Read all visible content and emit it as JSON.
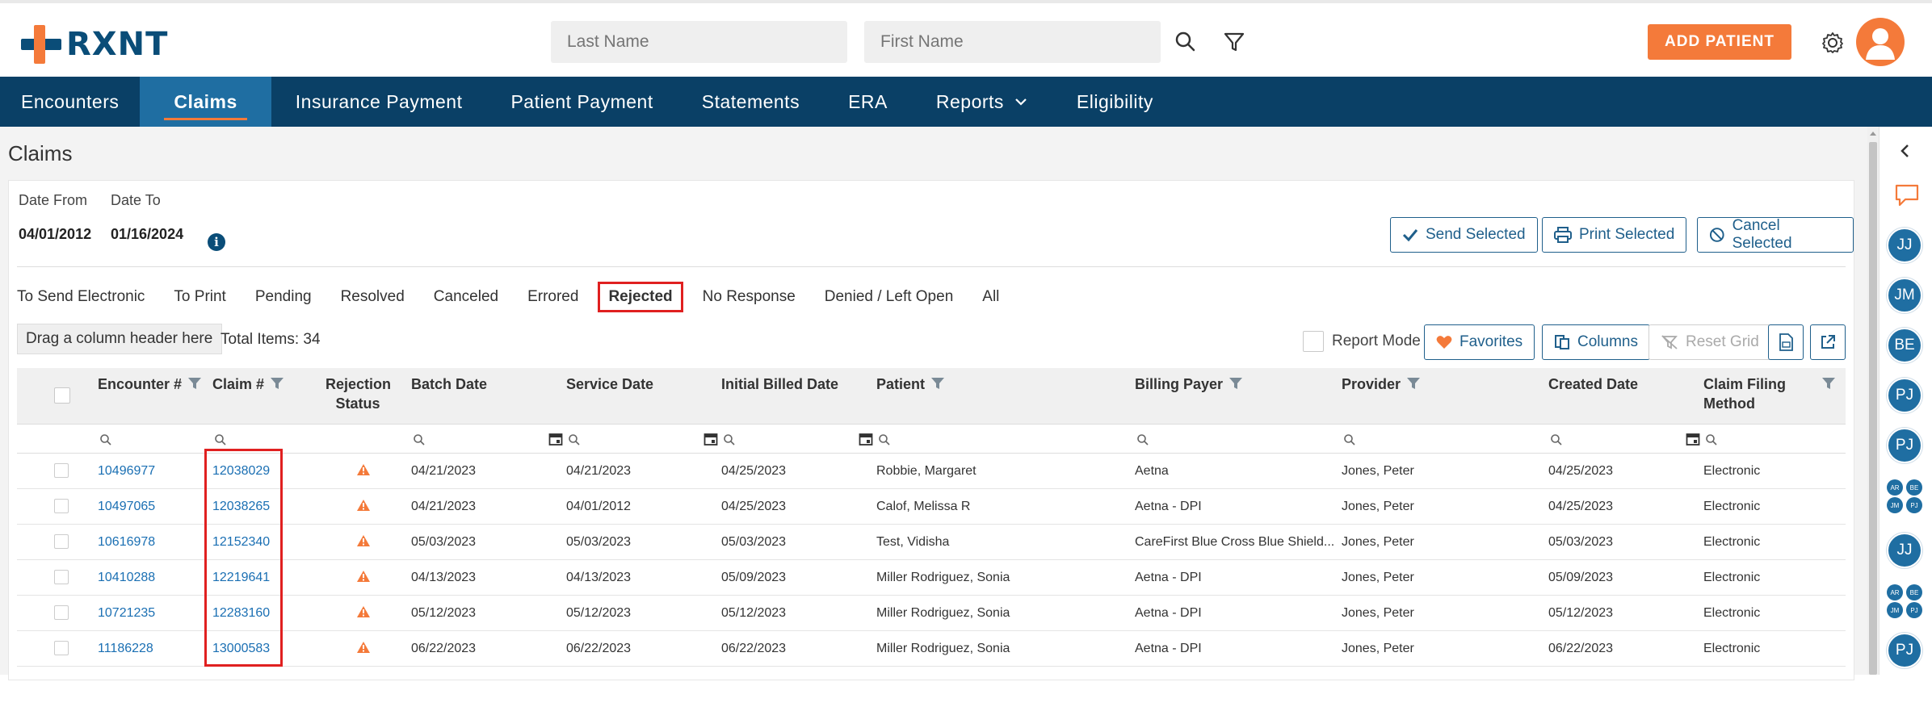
{
  "header": {
    "logo_text": "RXNT",
    "last_name_placeholder": "Last Name",
    "first_name_placeholder": "First Name",
    "add_patient_label": "ADD PATIENT",
    "accent_color": "#f47a3a",
    "brand_color": "#0a4066"
  },
  "nav": {
    "items": [
      "Encounters",
      "Claims",
      "Insurance Payment",
      "Patient Payment",
      "Statements",
      "ERA",
      "Reports",
      "Eligibility"
    ],
    "active": "Claims"
  },
  "page": {
    "title": "Claims"
  },
  "filters": {
    "date_from_label": "Date From",
    "date_to_label": "Date To",
    "date_from_value": "04/01/2012",
    "date_to_value": "01/16/2024"
  },
  "actions": {
    "send_selected": "Send Selected",
    "print_selected": "Print Selected",
    "cancel_selected": "Cancel Selected"
  },
  "tabs": [
    "To Send Electronic",
    "To Print",
    "Pending",
    "Resolved",
    "Canceled",
    "Errored",
    "Rejected",
    "No Response",
    "Denied / Left Open",
    "All"
  ],
  "selected_tab": "Rejected",
  "toolbar": {
    "group_hint": "Drag a column header here",
    "total_items": "Total Items: 34",
    "report_mode": "Report Mode",
    "favorites": "Favorites",
    "columns": "Columns",
    "reset_grid": "Reset Grid"
  },
  "grid": {
    "columns": {
      "encounter": "Encounter #",
      "claim": "Claim #",
      "rejection_status_1": "Rejection",
      "rejection_status_2": "Status",
      "batch_date": "Batch Date",
      "service_date": "Service Date",
      "initial_billed_date": "Initial Billed Date",
      "patient": "Patient",
      "billing_payer": "Billing Payer",
      "provider": "Provider",
      "created_date": "Created Date",
      "claim_filing_1": "Claim Filing",
      "claim_filing_2": "Method"
    },
    "rows": [
      {
        "encounter": "10496977",
        "claim": "12038029",
        "batch": "04/21/2023",
        "service": "04/21/2023",
        "billed": "04/25/2023",
        "patient": "Robbie, Margaret",
        "payer": "Aetna",
        "provider": "Jones, Peter",
        "created": "04/25/2023",
        "method": "Electronic"
      },
      {
        "encounter": "10497065",
        "claim": "12038265",
        "batch": "04/21/2023",
        "service": "04/01/2012",
        "billed": "04/25/2023",
        "patient": "Calof, Melissa R",
        "payer": "Aetna - DPI",
        "provider": "Jones, Peter",
        "created": "04/25/2023",
        "method": "Electronic"
      },
      {
        "encounter": "10616978",
        "claim": "12152340",
        "batch": "05/03/2023",
        "service": "05/03/2023",
        "billed": "05/03/2023",
        "patient": "Test, Vidisha",
        "payer": "CareFirst Blue Cross Blue Shield...",
        "provider": "Jones, Peter",
        "created": "05/03/2023",
        "method": "Electronic"
      },
      {
        "encounter": "10410288",
        "claim": "12219641",
        "batch": "04/13/2023",
        "service": "04/13/2023",
        "billed": "05/09/2023",
        "patient": "Miller Rodriguez, Sonia",
        "payer": "Aetna - DPI",
        "provider": "Jones, Peter",
        "created": "05/09/2023",
        "method": "Electronic"
      },
      {
        "encounter": "10721235",
        "claim": "12283160",
        "batch": "05/12/2023",
        "service": "05/12/2023",
        "billed": "05/12/2023",
        "patient": "Miller Rodriguez, Sonia",
        "payer": "Aetna - DPI",
        "provider": "Jones, Peter",
        "created": "05/12/2023",
        "method": "Electronic"
      },
      {
        "encounter": "11186228",
        "claim": "13000583",
        "batch": "06/22/2023",
        "service": "06/22/2023",
        "billed": "06/22/2023",
        "patient": "Miller Rodriguez, Sonia",
        "payer": "Aetna - DPI",
        "provider": "Jones, Peter",
        "created": "06/22/2023",
        "method": "Electronic"
      }
    ]
  },
  "right_panel": {
    "avatars": [
      "JJ",
      "JM",
      "BE",
      "PJ",
      "PJ",
      "JJ",
      "PJ"
    ],
    "group_1": [
      "AR",
      "BE",
      "JM",
      "PJ"
    ],
    "group_2": [
      "AR",
      "BE",
      "JM",
      "PJ"
    ]
  }
}
